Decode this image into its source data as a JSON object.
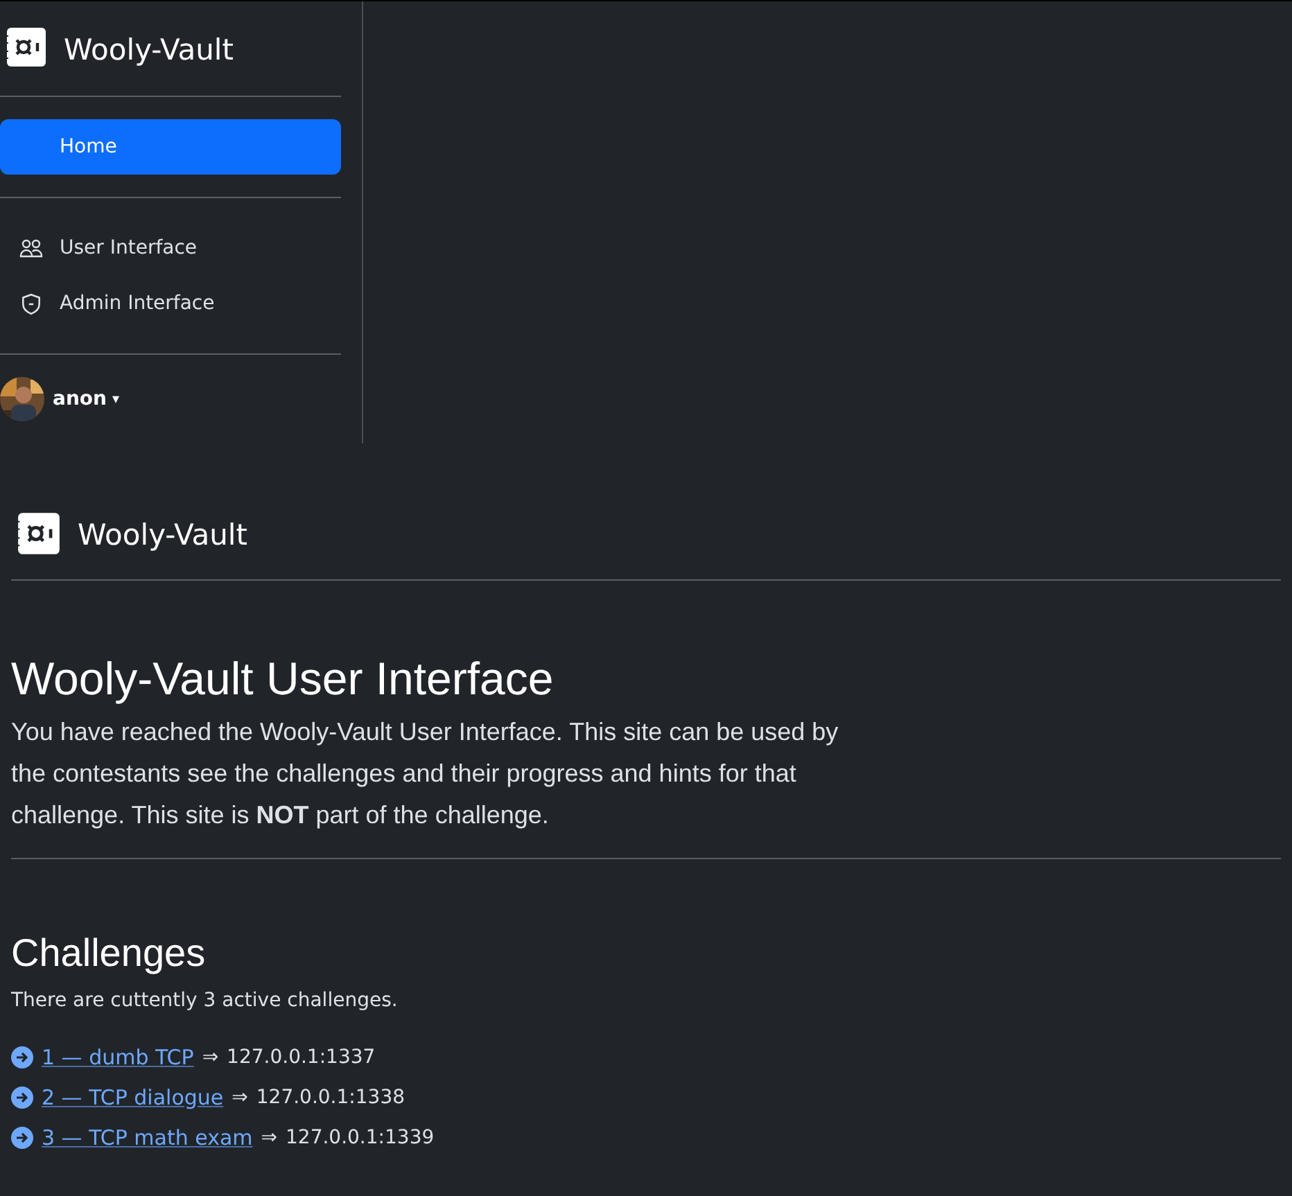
{
  "sidebar": {
    "brand": "Wooly-Vault",
    "primary_items": [
      {
        "label": "Home",
        "selected": true
      }
    ],
    "items": [
      {
        "label": "User Interface",
        "kind": "users",
        "selected": false
      },
      {
        "label": "Admin Interface",
        "kind": "shield",
        "selected": false
      }
    ],
    "user": {
      "name": "anon",
      "caret": "▾"
    }
  },
  "header": {
    "brand": "Wooly-Vault"
  },
  "intro": {
    "title": "Wooly-Vault User Interface",
    "text": "You have reached the Wooly-Vault User Interface. This site can be used by the contestants see the challenges and their progress and hints for that challenge. This site is **NOT** part of the challenge."
  },
  "challenges": {
    "title": "Challenges",
    "summary": "There are cuttently 3 active challenges.",
    "items": [
      {
        "link": "1 — dumb TCP",
        "separator": "⇒",
        "address": "127.0.0.1:1337"
      },
      {
        "link": "2 — TCP dialogue",
        "separator": "⇒",
        "address": "127.0.0.1:1338"
      },
      {
        "link": "3 — TCP math exam",
        "separator": "⇒",
        "address": "127.0.0.1:1339"
      }
    ]
  }
}
